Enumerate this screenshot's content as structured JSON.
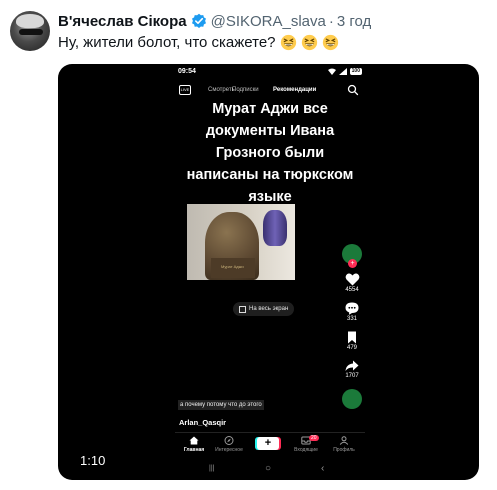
{
  "tweet": {
    "author_name": "В'ячеслав Сікора",
    "handle": "@SIKORA_slava",
    "separator": "·",
    "time_ago": "3 год",
    "text": "Ну, жители болот, что скажете?",
    "emojis": [
      "grinning-squinting-face",
      "grinning-squinting-face",
      "grinning-squinting-face"
    ],
    "verified_color": "#1d9bf0"
  },
  "video": {
    "duration": "1:10"
  },
  "phone": {
    "status_time": "09:54",
    "battery": "100",
    "nav_tabs": {
      "live": "LIVE",
      "watch": "Смотреть",
      "follow": "Подписки",
      "recommended": "Рекомендации"
    },
    "caption": "Мурат Аджи все документы Ивана Грозного были написаны на тюркском языке",
    "plaque_text": "Мурат Аджи",
    "fullscreen_label": "На весь экран",
    "likes": "4554",
    "comments": "331",
    "saves": "479",
    "shares": "1707",
    "reason_text": "а почему потому что до этого",
    "username": "Arlan_Qasqir",
    "bottom_nav": {
      "home": "Главная",
      "interesting": "Интересное",
      "inbox": "Входящие",
      "inbox_badge": "20",
      "profile": "Профиль"
    },
    "system_nav": {
      "recents": "|||",
      "home": "○",
      "back": "‹"
    }
  }
}
